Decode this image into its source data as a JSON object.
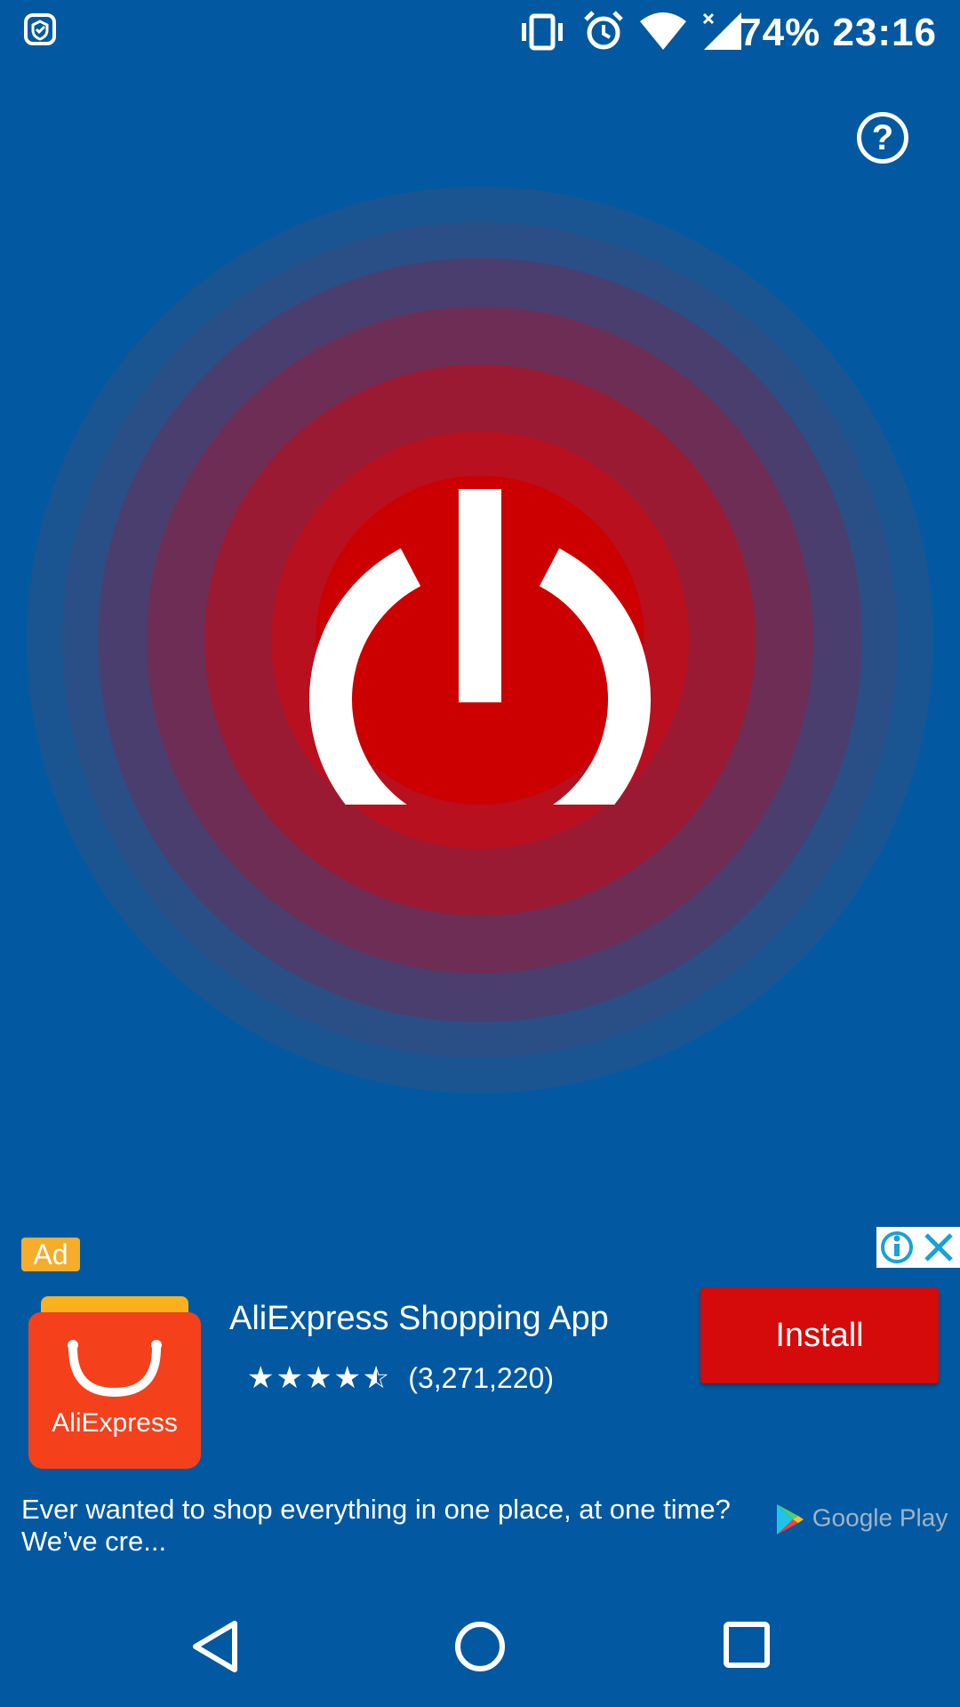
{
  "status_bar": {
    "battery": "74%",
    "time": "23:16",
    "icons": [
      "app-shield-icon",
      "vibrate-icon",
      "alarm-icon",
      "wifi-icon",
      "signal-icon"
    ]
  },
  "toolbar": {
    "help_label": "?"
  },
  "colors": {
    "background": "#0259a1",
    "power_red": "#cc0000",
    "install_red": "#d50a0a",
    "ad_badge": "#f6ad2b"
  },
  "ad": {
    "badge": "Ad",
    "app_name": "AliExpress Shopping App",
    "icon_label": "AliExpress",
    "rating_stars": 4.5,
    "rating_count": "(3,271,220)",
    "install_label": "Install",
    "description": "Ever wanted to shop everything in one place, at one time?\nWe’ve cre...",
    "store_label": "Google Play"
  },
  "navbar": {
    "buttons": [
      "back",
      "home",
      "recents"
    ]
  }
}
